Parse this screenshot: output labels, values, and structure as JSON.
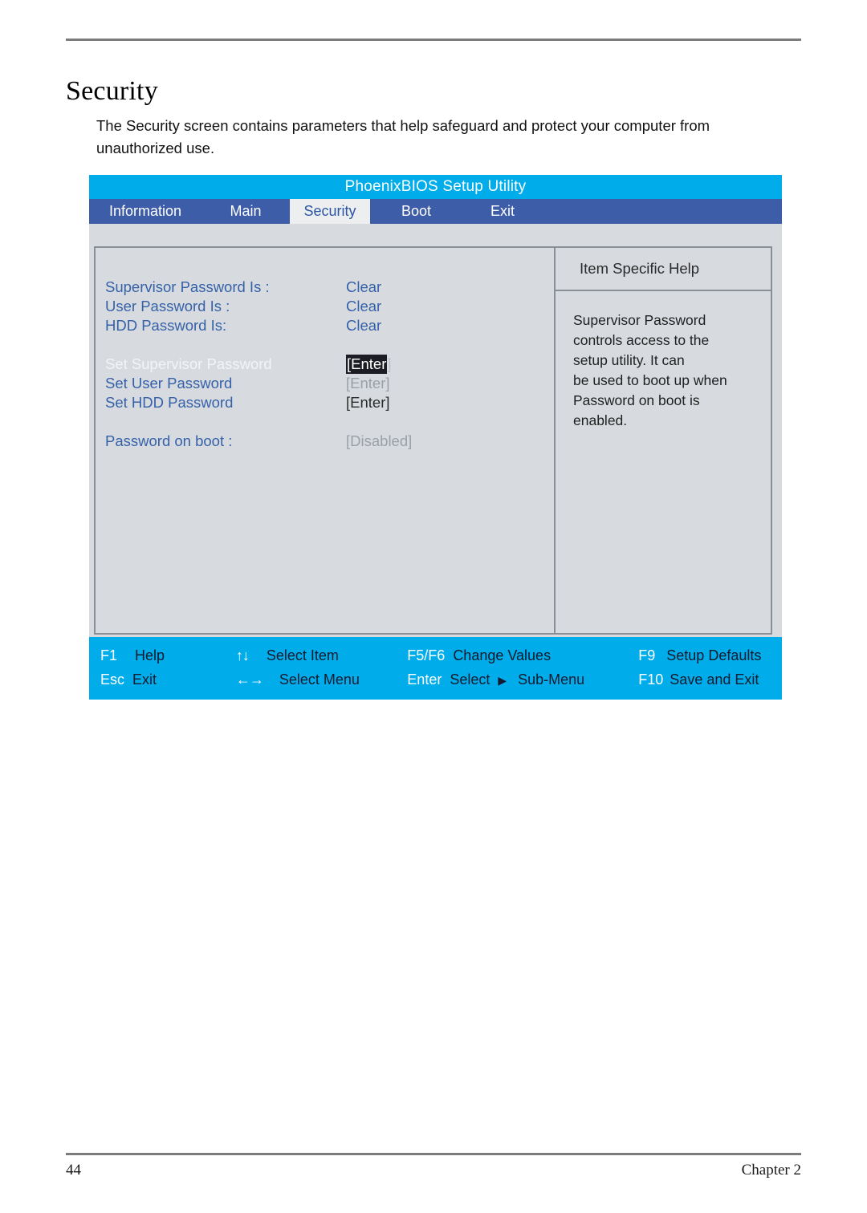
{
  "document": {
    "heading": "Security",
    "paragraph": "The Security screen contains parameters that help safeguard and protect your computer from unauthorized use.",
    "page_number": "44",
    "chapter": "Chapter 2"
  },
  "bios": {
    "title": "PhoenixBIOS Setup Utility",
    "tabs": [
      {
        "label": "Information",
        "active": false
      },
      {
        "label": "Main",
        "active": false
      },
      {
        "label": "Security",
        "active": true
      },
      {
        "label": "Boot",
        "active": false
      },
      {
        "label": "Exit",
        "active": false
      }
    ],
    "settings": [
      {
        "label": "Supervisor Password Is :",
        "value": "Clear"
      },
      {
        "label": "User Password Is :",
        "value": "Clear"
      },
      {
        "label": "HDD Password Is:",
        "value": "Clear"
      },
      {
        "label": "Set Supervisor Password",
        "value": "[Enter]"
      },
      {
        "label": "Set User Password",
        "value": "[Enter]"
      },
      {
        "label": "Set HDD Password",
        "value": "[Enter]"
      },
      {
        "label": "Password on boot :",
        "value": "[Disabled]"
      }
    ],
    "selected_item": "Set Supervisor Password",
    "selected_value_highlight": "[Enter",
    "selected_value_tail": "]",
    "help": {
      "header": "Item Specific Help",
      "body": "Supervisor Password\ncontrols access to the\nsetup utility. It can\nbe used to boot up when\nPassword on boot is\nenabled."
    },
    "keys": [
      {
        "key": "F1",
        "desc": "Help"
      },
      {
        "key": "↑↓",
        "desc": "Select Item"
      },
      {
        "key": "F5/F6",
        "desc": "Change Values"
      },
      {
        "key": "F9",
        "desc": "Setup Defaults"
      },
      {
        "key": "Esc",
        "desc": "Exit"
      },
      {
        "key": "←→",
        "desc": "Select Menu"
      },
      {
        "key": "Enter",
        "desc": "Select",
        "desc2": "Sub-Menu"
      },
      {
        "key": "F10",
        "desc": "Save and Exit"
      }
    ],
    "colors": {
      "title_bar": "#00adea",
      "tab_bar": "#3e5da8",
      "active_tab_bg": "#eceef0",
      "panel_bg": "#d7dbe0",
      "label_blue": "#3561a8",
      "key_bar": "#00adea"
    }
  }
}
